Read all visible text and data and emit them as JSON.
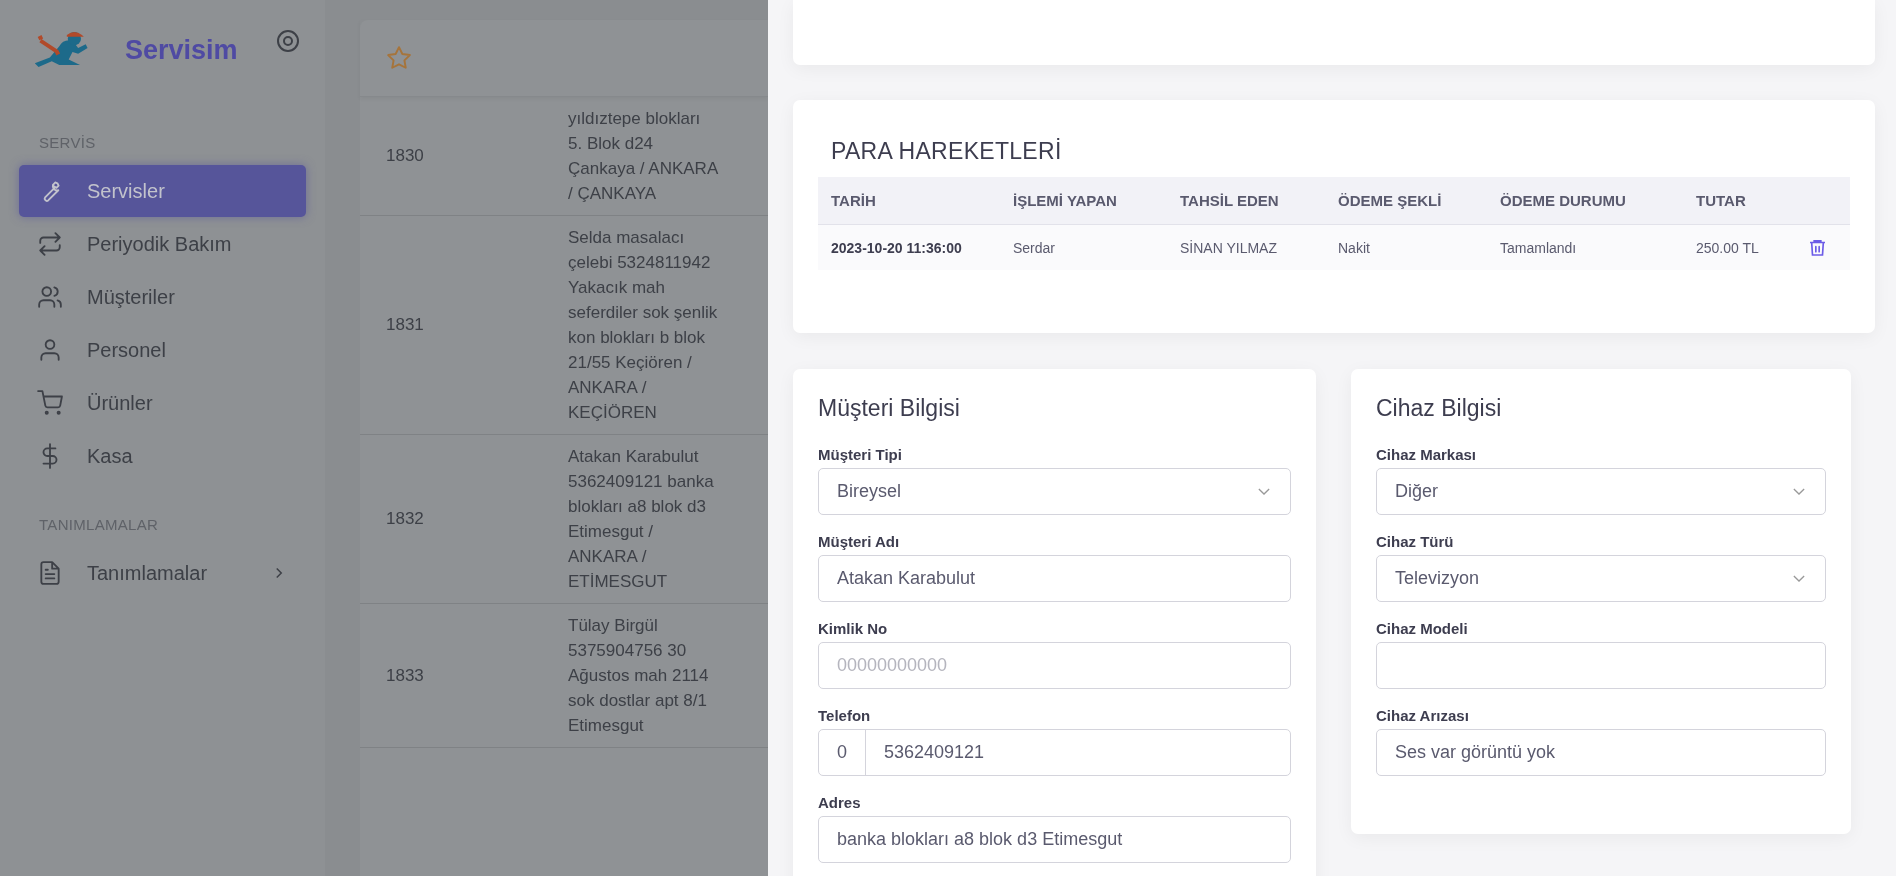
{
  "brand": {
    "name": "Servisim"
  },
  "sidebar": {
    "sections": [
      {
        "title": "SERVİS",
        "items": [
          {
            "label": "Servisler",
            "kind": "link",
            "selected": true
          },
          {
            "label": "Periyodik Bakım",
            "kind": "link",
            "selected": false
          },
          {
            "label": "Müşteriler",
            "kind": "link",
            "selected": false
          },
          {
            "label": "Personel",
            "kind": "link",
            "selected": false
          },
          {
            "label": "Ürünler",
            "kind": "link",
            "selected": false
          },
          {
            "label": "Kasa",
            "kind": "link",
            "selected": false
          }
        ]
      },
      {
        "title": "TANIMLAMALAR",
        "items": [
          {
            "label": "Tanımlamalar",
            "kind": "group",
            "selected": false
          }
        ]
      }
    ]
  },
  "services_table": {
    "rows": [
      {
        "id": "1830",
        "customer": "yıldıztepe blokları 5. Blok d24 Çankaya / ANKARA / ÇANKAYA"
      },
      {
        "id": "1831",
        "customer": "Selda masalacı çelebi 5324811942 Yakacık mah seferdiler sok şenlik kon blokları b blok 21/55 Keçiören / ANKARA / KEÇİÖREN"
      },
      {
        "id": "1832",
        "customer": "Atakan Karabulut 5362409121 banka blokları a8 blok d3 Etimesgut / ANKARA / ETİMESGUT"
      },
      {
        "id": "1833",
        "customer": "Tülay Birgül 5375904756 30 Ağustos mah 2114 sok dostlar apt 8/1 Etimesgut"
      }
    ]
  },
  "payments": {
    "title": "PARA HAREKETLERİ",
    "columns": [
      "TARİH",
      "İŞLEMİ YAPAN",
      "TAHSİL EDEN",
      "ÖDEME ŞEKLİ",
      "ÖDEME DURUMU",
      "TUTAR"
    ],
    "rows": [
      {
        "cells": [
          "2023-10-20 11:36:00",
          "Serdar",
          "SİNAN YILMAZ",
          "Nakit",
          "Tamamlandı",
          "250.00 TL"
        ]
      }
    ]
  },
  "customer_info": {
    "title": "Müşteri Bilgisi",
    "fields": [
      {
        "label": "Müşteri Tipi",
        "kind": "select",
        "value": "Bireysel"
      },
      {
        "label": "Müşteri Adı",
        "kind": "input",
        "value": "Atakan Karabulut"
      },
      {
        "label": "Kimlik No",
        "kind": "input",
        "placeholder": "00000000000"
      },
      {
        "label": "Telefon",
        "kind": "phone",
        "prefix": "0",
        "value": "5362409121"
      },
      {
        "label": "Adres",
        "kind": "input",
        "value": "banka blokları a8 blok d3 Etimesgut"
      }
    ]
  },
  "device_info": {
    "title": "Cihaz Bilgisi",
    "fields": [
      {
        "label": "Cihaz Markası",
        "kind": "select",
        "value": "Diğer"
      },
      {
        "label": "Cihaz Türü",
        "kind": "select",
        "value": "Televizyon"
      },
      {
        "label": "Cihaz Modeli",
        "kind": "input"
      },
      {
        "label": "Cihaz Arızası",
        "kind": "input",
        "value": "Ses var görüntü yok"
      }
    ]
  }
}
